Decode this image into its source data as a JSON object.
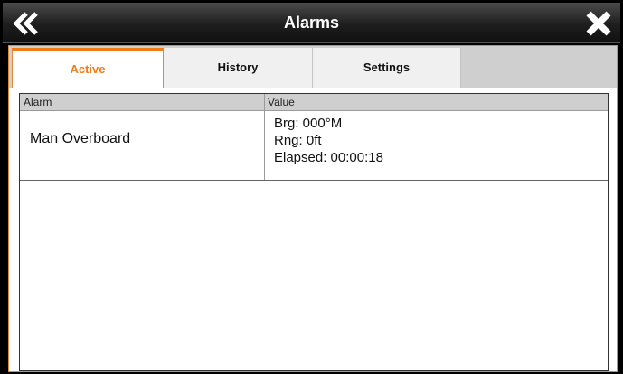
{
  "header": {
    "title": "Alarms"
  },
  "tabs": [
    {
      "label": "Active",
      "selected": true
    },
    {
      "label": "History",
      "selected": false
    },
    {
      "label": "Settings",
      "selected": false
    }
  ],
  "table": {
    "columns": [
      "Alarm",
      "Value"
    ],
    "rows": [
      {
        "alarm": "Man Overboard",
        "values": [
          "Brg: 000°M",
          "Rng: 0ft",
          "Elapsed: 00:00:18"
        ]
      }
    ]
  },
  "colors": {
    "accent": "#f07b17",
    "titlebar": "#1e1e1e",
    "header_bg": "#cfcfcf"
  },
  "icons": {
    "back": "double-chevron-left-icon",
    "close": "close-icon"
  }
}
